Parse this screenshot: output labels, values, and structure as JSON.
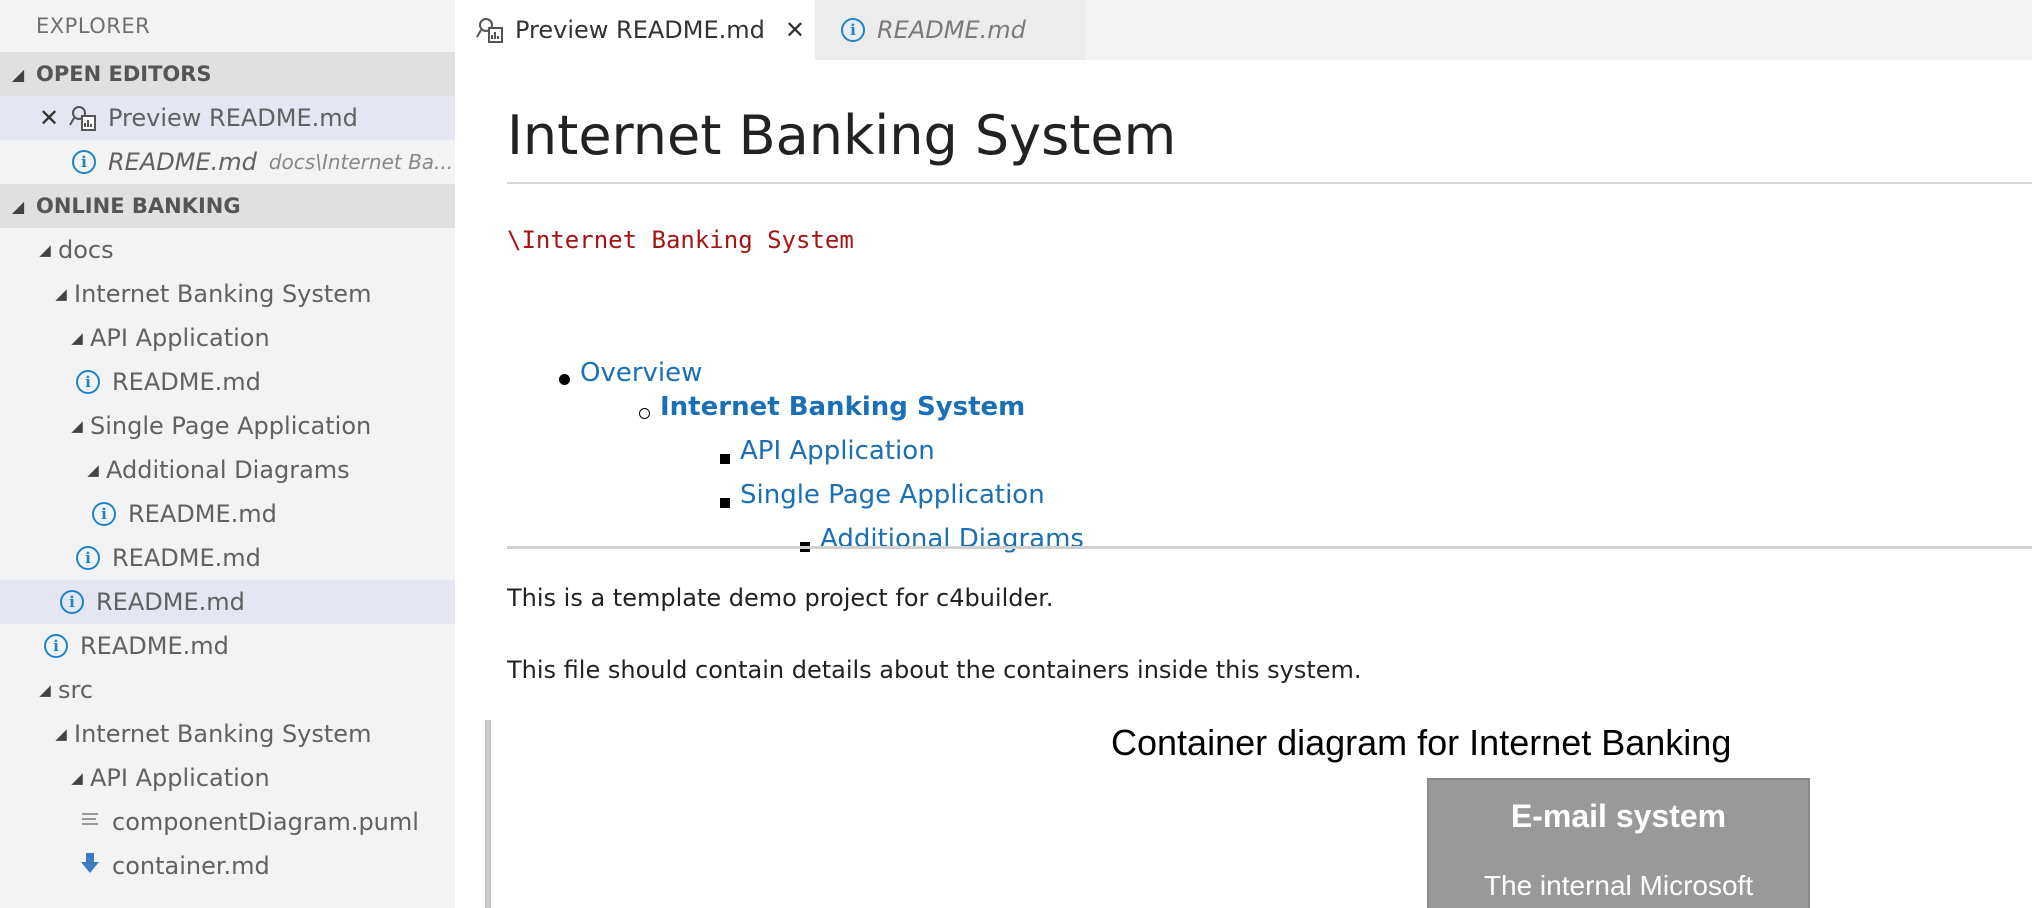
{
  "sidebar": {
    "title": "EXPLORER",
    "open_editors": {
      "heading": "OPEN EDITORS",
      "items": [
        {
          "label": "Preview README.md"
        },
        {
          "label": "README.md",
          "description": "docs\\Internet Ba..."
        }
      ]
    },
    "workspace": {
      "heading": "ONLINE BANKING",
      "tree": [
        {
          "label": "docs"
        },
        {
          "label": "Internet Banking System"
        },
        {
          "label": "API Application"
        },
        {
          "label": "README.md"
        },
        {
          "label": "Single Page Application"
        },
        {
          "label": "Additional Diagrams"
        },
        {
          "label": "README.md"
        },
        {
          "label": "README.md"
        },
        {
          "label": "README.md"
        },
        {
          "label": "README.md"
        },
        {
          "label": "src"
        },
        {
          "label": "Internet Banking System"
        },
        {
          "label": "API Application"
        },
        {
          "label": "componentDiagram.puml"
        },
        {
          "label": "container.md"
        }
      ]
    }
  },
  "tabs": [
    {
      "label": "Preview README.md",
      "close": "✕"
    },
    {
      "label": "README.md"
    }
  ],
  "preview": {
    "heading": "Internet Banking System",
    "code_path": "\\Internet Banking System",
    "toc": [
      {
        "label": "Overview"
      },
      {
        "label": "Internet Banking System"
      },
      {
        "label": "API Application"
      },
      {
        "label": "Single Page Application"
      },
      {
        "label": "Additional Diagrams"
      }
    ],
    "paragraph_1": "This is a template demo project for c4builder.",
    "paragraph_2": "This file should contain details about the containers inside this system.",
    "diagram": {
      "title": "Container diagram for Internet Banking",
      "external_system": {
        "name": "E-mail system",
        "description": "The internal Microsoft"
      }
    }
  },
  "colors": {
    "link": "#1a6fb5",
    "code": "#a31515",
    "selection": "#e4e6f1",
    "info_icon": "#1a85c8"
  }
}
